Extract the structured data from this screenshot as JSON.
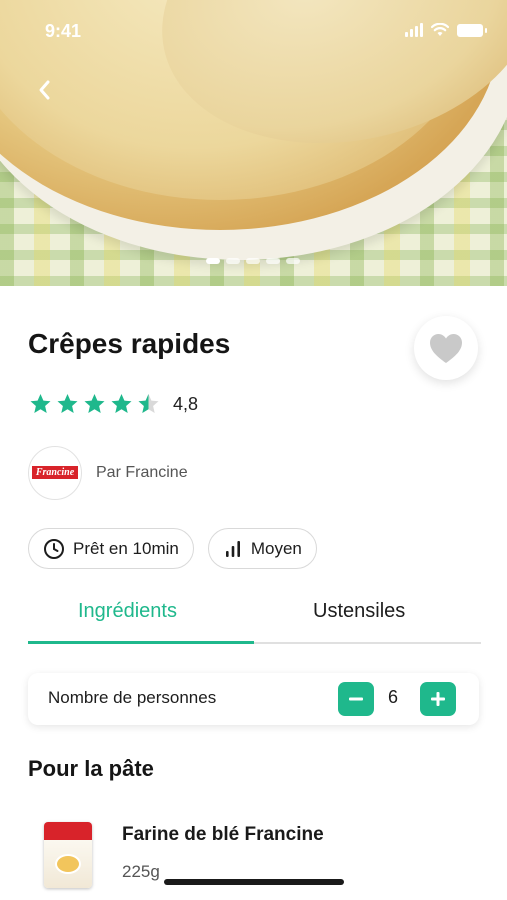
{
  "status_bar": {
    "time": "9:41"
  },
  "hero": {
    "image_alt": "crepes-photo",
    "page_count": 5,
    "active_page": 0
  },
  "recipe": {
    "title": "Crêpes rapides",
    "rating": {
      "value_text": "4,8",
      "value": 4.8,
      "max": 5
    },
    "author_text": "Par Francine",
    "brand_logo_text": "Francine",
    "chips": [
      {
        "icon": "clock-icon",
        "label": "Prêt en 10min"
      },
      {
        "icon": "difficulty-bars-icon",
        "label": "Moyen"
      }
    ]
  },
  "tabs": [
    {
      "label": "Ingrédients",
      "active": true
    },
    {
      "label": "Ustensiles",
      "active": false
    }
  ],
  "servings": {
    "label": "Nombre de personnes",
    "count": "6"
  },
  "section_title": "Pour la pâte",
  "ingredients": [
    {
      "name": "Farine de blé Francine",
      "quantity": "225g"
    }
  ],
  "colors": {
    "accent": "#1fb88c",
    "star": "#1fb88c",
    "brand_red": "#d8232a"
  }
}
